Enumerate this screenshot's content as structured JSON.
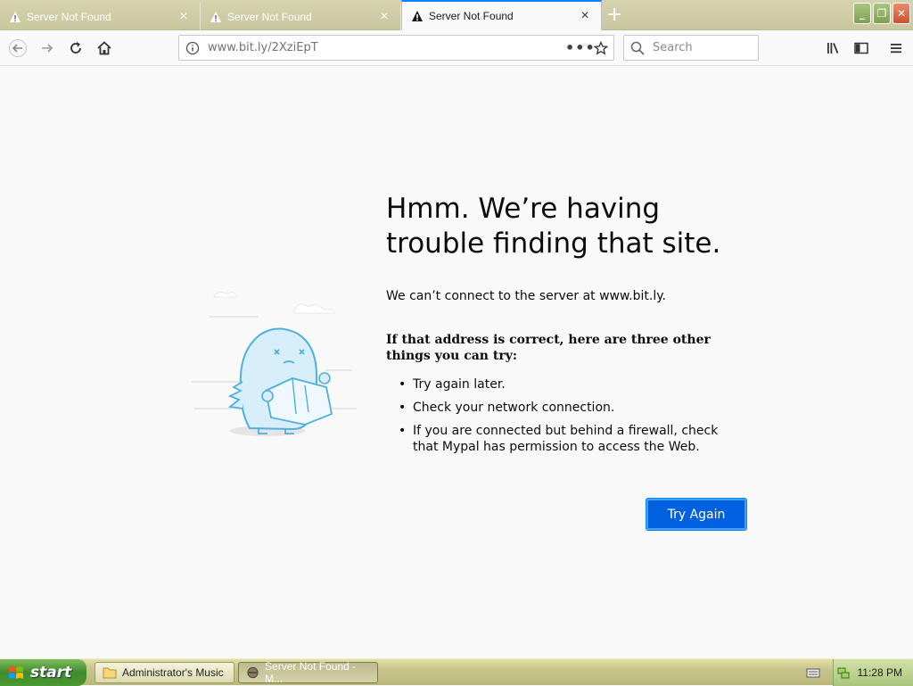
{
  "browser": {
    "tabs": [
      {
        "label": "Server Not Found",
        "active": false
      },
      {
        "label": "Server Not Found",
        "active": false
      },
      {
        "label": "Server Not Found",
        "active": true
      }
    ],
    "new_tab_icon": "plus-icon",
    "url": "www.bit.ly/2XziEpT",
    "search_placeholder": "Search",
    "window_buttons": [
      "minimize",
      "maximize",
      "close"
    ]
  },
  "error_page": {
    "title": "Hmm. We’re having trouble finding that site.",
    "lead": "We can’t connect to the server at www.bit.ly.",
    "subhead": "If that address is correct, here are three other things you can try:",
    "tips": [
      "Try again later.",
      "Check your network connection.",
      "If you are connected but behind a firewall, check that Mypal has permission to access the Web."
    ],
    "try_again_label": "Try Again"
  },
  "taskbar": {
    "start_label": "start",
    "items": [
      {
        "label": "Administrator's Music",
        "active": false
      },
      {
        "label": "Server Not Found - M...",
        "active": true
      }
    ],
    "clock": "11:28 PM"
  },
  "colors": {
    "accent": "#0060df",
    "tab_highlight": "#0a84ff",
    "page_bg": "#f9f9fa"
  }
}
